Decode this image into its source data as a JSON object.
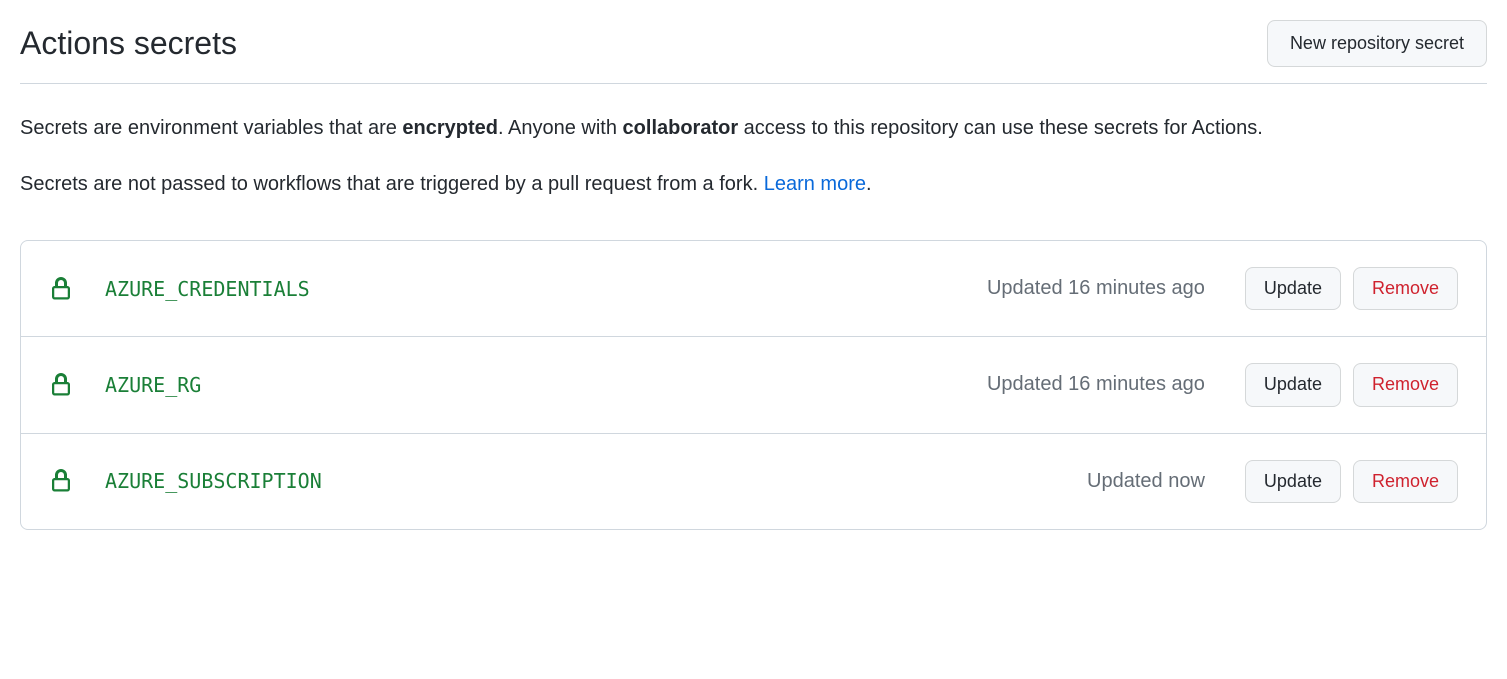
{
  "header": {
    "title": "Actions secrets",
    "new_secret_button": "New repository secret"
  },
  "description": {
    "para1_prefix": "Secrets are environment variables that are ",
    "para1_bold1": "encrypted",
    "para1_mid": ". Anyone with ",
    "para1_bold2": "collaborator",
    "para1_suffix": " access to this repository can use these secrets for Actions.",
    "para2_text": "Secrets are not passed to workflows that are triggered by a pull request from a fork. ",
    "learn_more": "Learn more",
    "para2_suffix": "."
  },
  "buttons": {
    "update": "Update",
    "remove": "Remove"
  },
  "secrets": [
    {
      "name": "AZURE_CREDENTIALS",
      "updated": "Updated 16 minutes ago"
    },
    {
      "name": "AZURE_RG",
      "updated": "Updated 16 minutes ago"
    },
    {
      "name": "AZURE_SUBSCRIPTION",
      "updated": "Updated now"
    }
  ]
}
